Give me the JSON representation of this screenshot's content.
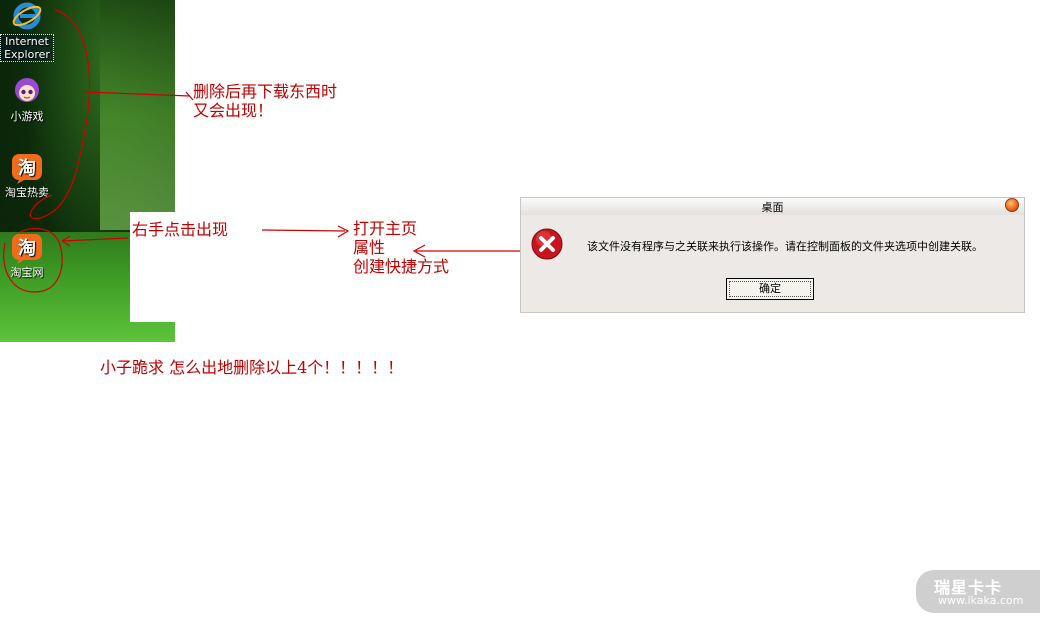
{
  "desktop": {
    "icons": [
      {
        "label": "Internet Explorer",
        "line1": "Internet",
        "line2": "Explorer",
        "icon": "ie-icon"
      },
      {
        "label": "小游戏",
        "icon": "game-icon"
      },
      {
        "label": "淘宝热卖",
        "icon": "taobao-hot-icon"
      },
      {
        "label": "淘宝网",
        "icon": "taobao-icon"
      }
    ]
  },
  "dialog": {
    "title": "桌面",
    "message": "该文件没有程序与之关联来执行该操作。请在控制面板的文件夹选项中创建关联。",
    "ok_label": "确定",
    "icon": "error-icon"
  },
  "annotations": {
    "delete_line1": "删除后再下载东西时",
    "delete_line2": "又会出现！",
    "right_click": "右手点击出现",
    "menu_items": [
      "打开主页",
      "属性",
      "创建快捷方式"
    ],
    "question": "小子跪求   怎么出地删除以上4个！！！！！"
  },
  "watermark": {
    "brand": "瑞星卡卡",
    "url": "www.ikaka.com"
  },
  "colors": {
    "annotation": "#c00000",
    "dialog_bg": "#ece9e6"
  }
}
